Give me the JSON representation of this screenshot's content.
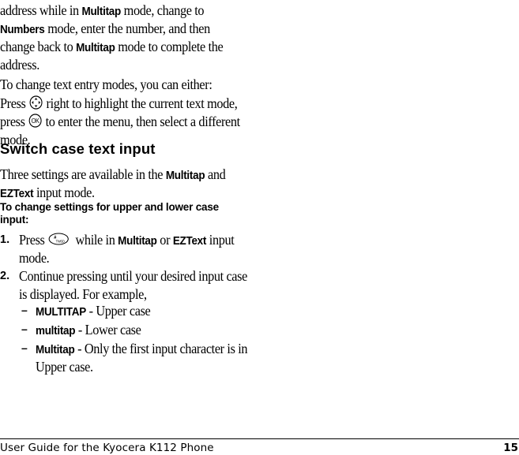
{
  "intro": {
    "line1": [
      "address while in ",
      "Multitap",
      " mode, change to"
    ],
    "line2": [
      "Numbers",
      " mode, enter the number, and then"
    ],
    "line3": [
      "change back to ",
      "Multitap",
      " mode to complete the"
    ],
    "line4": "address."
  },
  "change_modes": {
    "lead": "To change text entry modes, you can either:",
    "line1_a": "Press",
    "line1_b": "right to highlight the current text mode,",
    "line2_a": "press",
    "line2_b": "to enter the menu, then select a different",
    "line3": "mode.",
    "icons": {
      "navigation": "navigation-key-icon",
      "ok": "ok-key-icon",
      "ok_label": "OK"
    }
  },
  "section": {
    "title": "Switch case text input",
    "desc_line1": [
      "Three settings are available in the ",
      "Multitap",
      " and"
    ],
    "desc_line2": [
      "EZText",
      " input mode."
    ],
    "procedure_title_line1": "To change settings for upper and lower case",
    "procedure_title_line2": "input:",
    "steps": [
      {
        "number": "1.",
        "line1": [
          "Press",
          " while in ",
          "Multitap",
          " or ",
          "EZText",
          " input"
        ],
        "line2": "mode.",
        "icon": "pound-shift-key-icon"
      },
      {
        "number": "2.",
        "line1": "Continue pressing until your desired input case",
        "line2": "is displayed. For example,"
      }
    ],
    "examples": [
      {
        "dash": "–",
        "term": "MULTITAP",
        "desc": " - Upper case"
      },
      {
        "dash": "–",
        "term": "multitap",
        "desc": " - Lower case"
      },
      {
        "dash": "–",
        "term": "Multitap",
        "desc": " - Only the first input character is in",
        "desc2": "Upper case."
      }
    ]
  },
  "footer": {
    "title": "User Guide for the Kyocera K112 Phone",
    "page_number": "15"
  }
}
